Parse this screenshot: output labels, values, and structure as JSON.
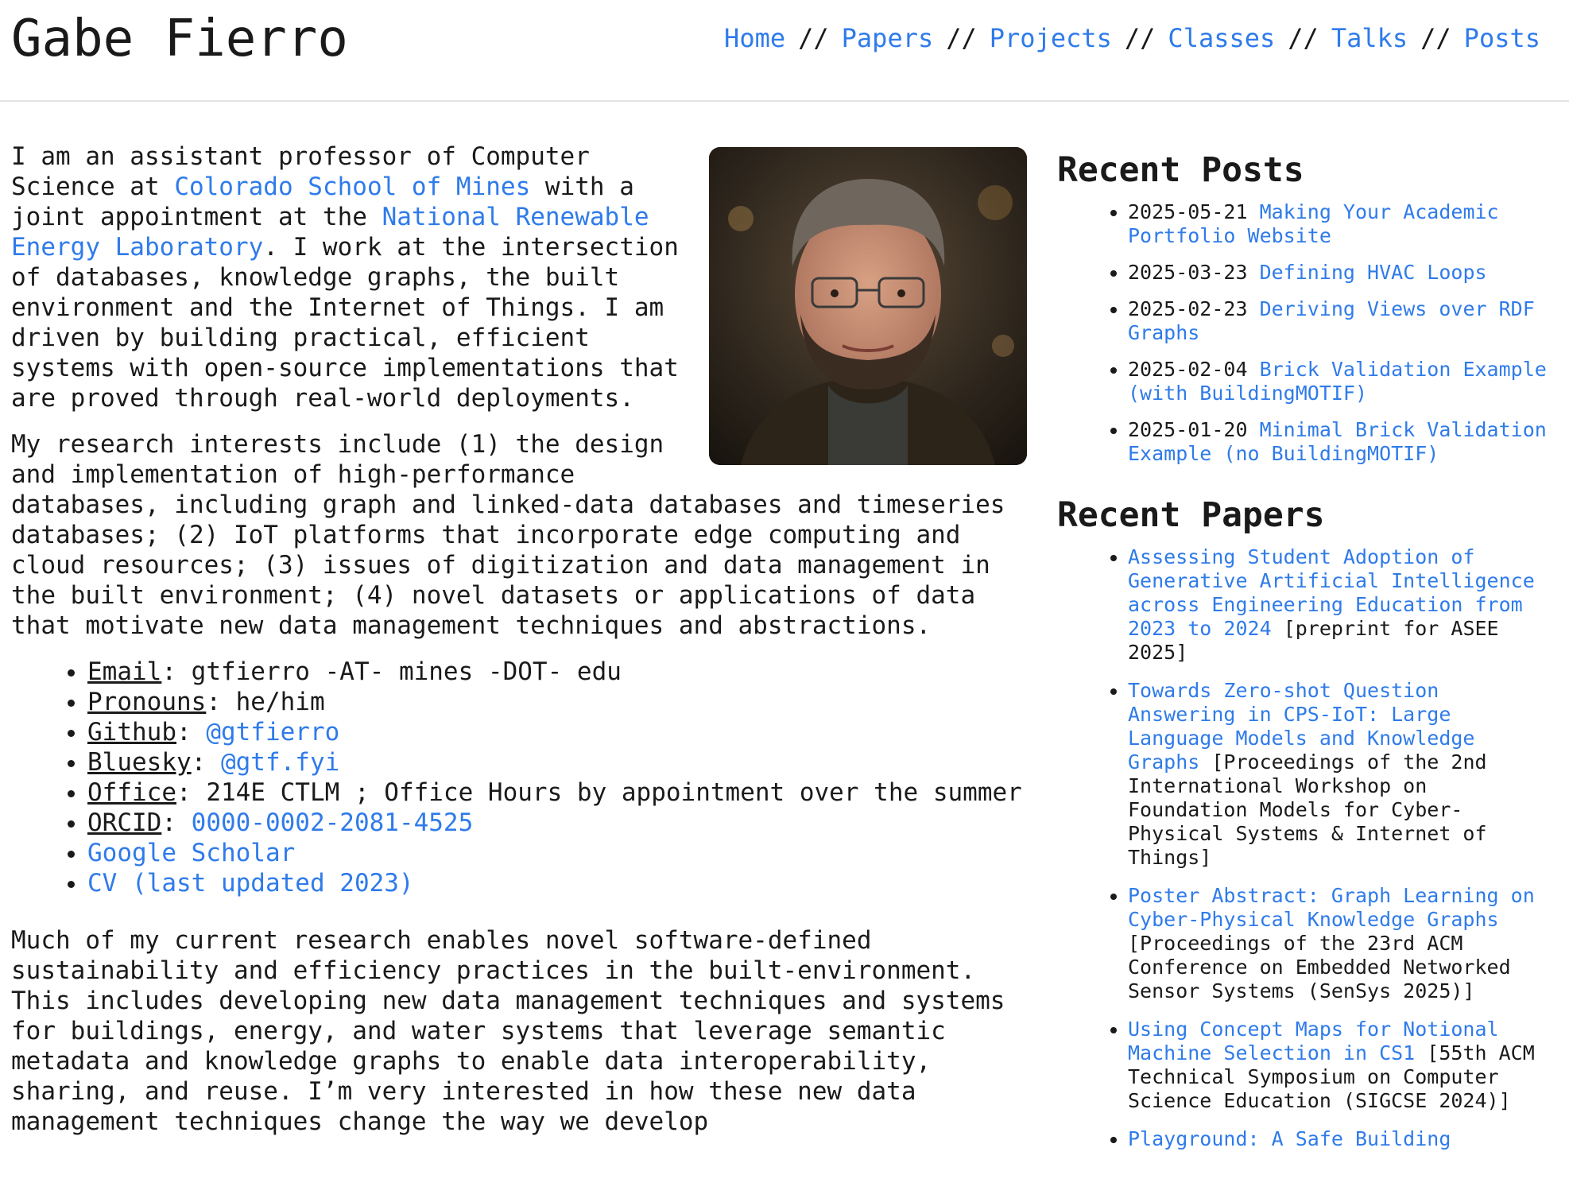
{
  "site": {
    "title": "Gabe Fierro"
  },
  "nav": {
    "separator": "//",
    "items": [
      {
        "label": "Home"
      },
      {
        "label": "Papers"
      },
      {
        "label": "Projects"
      },
      {
        "label": "Classes"
      },
      {
        "label": "Talks"
      },
      {
        "label": "Posts"
      }
    ]
  },
  "intro": {
    "p1_a": "I am an assistant professor of Computer Science at ",
    "mines_link": "Colorado School of Mines",
    "p1_b": " with a joint appointment at the ",
    "nrel_link": "National Renewable Energy Laboratory",
    "p1_c": ". I work at the intersection of databases, knowledge graphs, the built environment and the Internet of Things. I am driven by building practical, efficient systems with open-source implementations that are proved through real-world deployments.",
    "p2": "My research interests include (1) the design and implementation of high-performance databases, including graph and linked-data databases and timeseries databases; (2) IoT platforms that incorporate edge computing and cloud resources; (3) issues of digitization and data management in the built environment; (4) novel datasets or applications of data that motivate new data management techniques and abstractions."
  },
  "info": {
    "email_key": "Email",
    "email_value": "gtfierro -AT- mines -DOT- edu",
    "pronouns_key": "Pronouns",
    "pronouns_value": "he/him",
    "github_key": "Github",
    "github_value": "@gtfierro",
    "bluesky_key": "Bluesky",
    "bluesky_value": "@gtf.fyi",
    "office_key": "Office",
    "office_value": "214E CTLM ; Office Hours by appointment over the summer",
    "orcid_key": "ORCID",
    "orcid_value": "0000-0002-2081-4525",
    "scholar_link": "Google Scholar",
    "cv_link": "CV (last updated 2023)",
    "colon": ": "
  },
  "research": {
    "p3": "Much of my current research enables novel software-defined sustainability and efficiency practices in the built-environment. This includes developing new data management techniques and systems for buildings, energy, and water systems that leverage semantic metadata and knowledge graphs to enable data interoperability, sharing, and reuse. I’m very interested in how these new data management techniques change the way we develop"
  },
  "sidebar": {
    "posts_heading": "Recent Posts",
    "posts": [
      {
        "date": "2025-05-21",
        "title": "Making Your Academic Portfolio Website"
      },
      {
        "date": "2025-03-23",
        "title": "Defining HVAC Loops"
      },
      {
        "date": "2025-02-23",
        "title": "Deriving Views over RDF Graphs"
      },
      {
        "date": "2025-02-04",
        "title": "Brick Validation Example (with BuildingMOTIF)"
      },
      {
        "date": "2025-01-20",
        "title": "Minimal Brick Validation Example (no BuildingMOTIF)"
      }
    ],
    "papers_heading": "Recent Papers",
    "papers": [
      {
        "title": "Assessing Student Adoption of Generative Artificial Intelligence across Engineering Education from 2023 to 2024",
        "venue": "[preprint for ASEE 2025]"
      },
      {
        "title": "Towards Zero-shot Question Answering in CPS-IoT: Large Language Models and Knowledge Graphs",
        "venue": "[Proceedings of the 2nd International Workshop on Foundation Models for Cyber-Physical Systems & Internet of Things]"
      },
      {
        "title": "Poster Abstract: Graph Learning on Cyber-Physical Knowledge Graphs",
        "venue": "[Proceedings of the 23rd ACM Conference on Embedded Networked Sensor Systems (SenSys 2025)]"
      },
      {
        "title": "Using Concept Maps for Notional Machine Selection in CS1",
        "venue": "[55th ACM Technical Symposium on Computer Science Education (SIGCSE 2024)]"
      },
      {
        "title": "Playground: A Safe Building",
        "venue": ""
      }
    ]
  },
  "colors": {
    "link": "#2f7bea",
    "text": "#1a1a1a",
    "rule": "#e2e2e2"
  }
}
